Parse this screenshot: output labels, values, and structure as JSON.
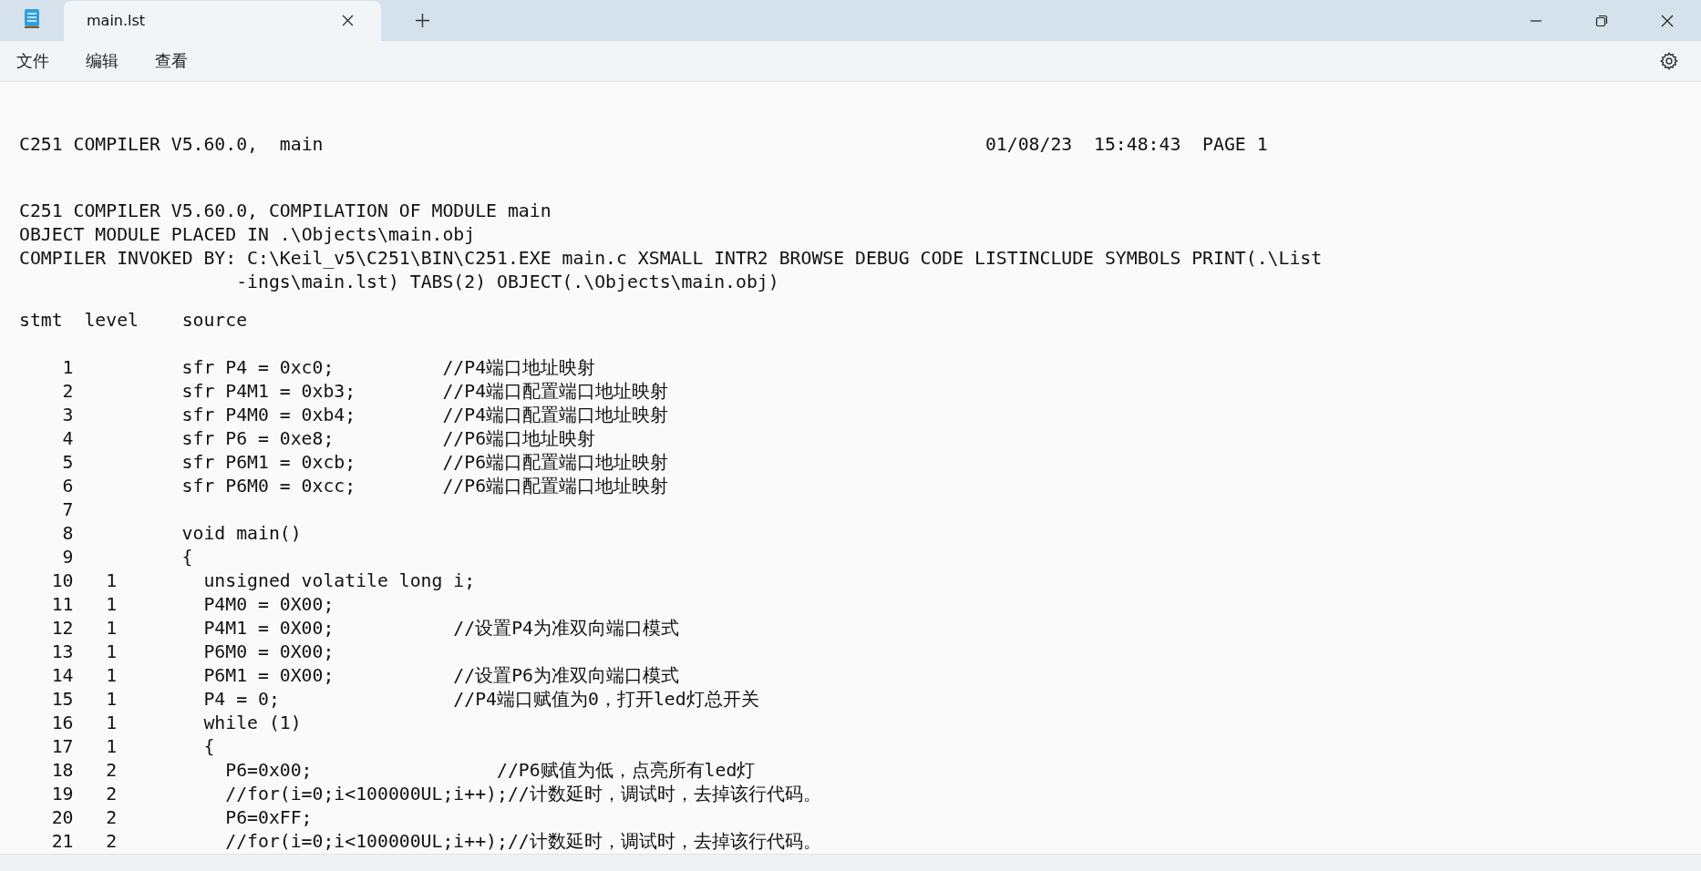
{
  "window": {
    "tab_title": "main.lst"
  },
  "menu": [
    "文件",
    "编辑",
    "查看"
  ],
  "listing": {
    "page_header": {
      "left": "C251 COMPILER V5.60.0,  main",
      "right": "01/08/23  15:48:43  PAGE 1"
    },
    "info_lines": [
      "C251 COMPILER V5.60.0, COMPILATION OF MODULE main",
      "OBJECT MODULE PLACED IN .\\Objects\\main.obj",
      "COMPILER INVOKED BY: C:\\Keil_v5\\C251\\BIN\\C251.EXE main.c XSMALL INTR2 BROWSE DEBUG CODE LISTINCLUDE SYMBOLS PRINT(.\\List"
    ],
    "info_continuation": "-ings\\main.lst) TABS(2) OBJECT(.\\Objects\\main.obj)",
    "columns": [
      "stmt",
      "level",
      "source"
    ],
    "rows": [
      {
        "stmt": "1",
        "source": "sfr P4 = 0xc0;          //P4端口地址映射"
      },
      {
        "stmt": "2",
        "source": "sfr P4M1 = 0xb3;        //P4端口配置端口地址映射"
      },
      {
        "stmt": "3",
        "source": "sfr P4M0 = 0xb4;        //P4端口配置端口地址映射"
      },
      {
        "stmt": "4",
        "source": "sfr P6 = 0xe8;          //P6端口地址映射"
      },
      {
        "stmt": "5",
        "source": "sfr P6M1 = 0xcb;        //P6端口配置端口地址映射"
      },
      {
        "stmt": "6",
        "source": "sfr P6M0 = 0xcc;        //P6端口配置端口地址映射"
      },
      {
        "stmt": "7"
      },
      {
        "stmt": "8",
        "source": "void main()"
      },
      {
        "stmt": "9",
        "source": "{"
      },
      {
        "stmt": "10",
        "level": "1",
        "source": "  unsigned volatile long i;"
      },
      {
        "stmt": "11",
        "level": "1",
        "source": "  P4M0 = 0X00;"
      },
      {
        "stmt": "12",
        "level": "1",
        "source": "  P4M1 = 0X00;           //设置P4为准双向端口模式"
      },
      {
        "stmt": "13",
        "level": "1",
        "source": "  P6M0 = 0X00;"
      },
      {
        "stmt": "14",
        "level": "1",
        "source": "  P6M1 = 0X00;           //设置P6为准双向端口模式"
      },
      {
        "stmt": "15",
        "level": "1",
        "source": "  P4 = 0;                //P4端口赋值为0，打开led灯总开关"
      },
      {
        "stmt": "16",
        "level": "1",
        "source": "  while (1)"
      },
      {
        "stmt": "17",
        "level": "1",
        "source": "  {"
      },
      {
        "stmt": "18",
        "level": "2",
        "source": "    P6=0x00;                 //P6赋值为低，点亮所有led灯"
      },
      {
        "stmt": "19",
        "level": "2",
        "source": "    //for(i=0;i<100000UL;i++);//计数延时，调试时，去掉该行代码。"
      },
      {
        "stmt": "20",
        "level": "2",
        "source": "    P6=0xFF;"
      },
      {
        "stmt": "21",
        "level": "2",
        "source": "    //for(i=0;i<100000UL;i++);//计数延时，调试时，去掉该行代码。"
      }
    ]
  }
}
